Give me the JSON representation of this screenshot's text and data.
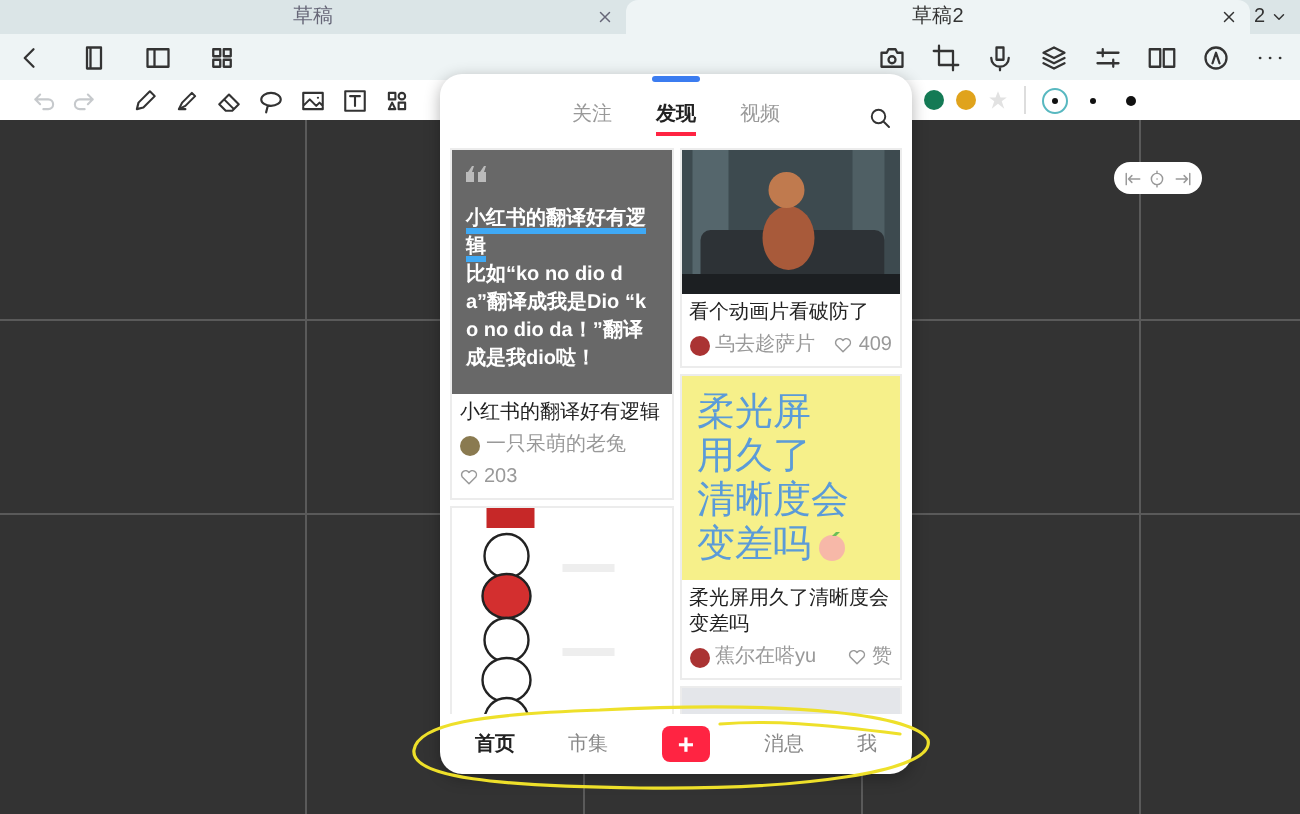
{
  "tabs": [
    {
      "label": "草稿",
      "selected": false
    },
    {
      "label": "草稿2",
      "selected": true
    }
  ],
  "tab_count": "2",
  "history": {
    "undo_disabled": true,
    "redo_disabled": true
  },
  "pen_colors": [
    {
      "color": "#147a55"
    },
    {
      "color": "#e0a31c"
    }
  ],
  "pen_sizes": [
    {
      "selected": true
    },
    {
      "selected": false
    },
    {
      "selected": false
    }
  ],
  "feed": {
    "tabs": [
      {
        "label": "关注",
        "selected": false
      },
      {
        "label": "发现",
        "selected": true
      },
      {
        "label": "视频",
        "selected": false
      }
    ],
    "columns": [
      [
        {
          "kind": "quote",
          "highlight": "小红书的翻译好有逻辑",
          "body": "比如“ko no dio da”翻译成我是Dio “ko no dio da！”翻译成是我dio哒！",
          "title": "小红书的翻译好有逻辑",
          "author": "一只呆萌的老兔",
          "likes": "203"
        },
        {
          "kind": "picture"
        }
      ],
      [
        {
          "title": "看个动画片看破防了",
          "author": "乌去趁萨片",
          "likes": "409"
        },
        {
          "kind": "cover",
          "cover_lines": [
            "柔光屏",
            "用久了",
            "清晰度会",
            "变差吗"
          ],
          "title": "柔光屏用久了清晰度会变差吗",
          "author": "蕉尔在嗒yu",
          "likes": "赞"
        },
        {
          "kind": "picture"
        }
      ]
    ]
  },
  "nav": [
    {
      "kind": "tab",
      "label": "首页",
      "selected": true
    },
    {
      "kind": "tab",
      "label": "市集",
      "selected": false
    },
    {
      "kind": "add",
      "label": "+"
    },
    {
      "kind": "tab",
      "label": "消息",
      "selected": false
    },
    {
      "kind": "tab",
      "label": "我",
      "selected": false
    }
  ]
}
